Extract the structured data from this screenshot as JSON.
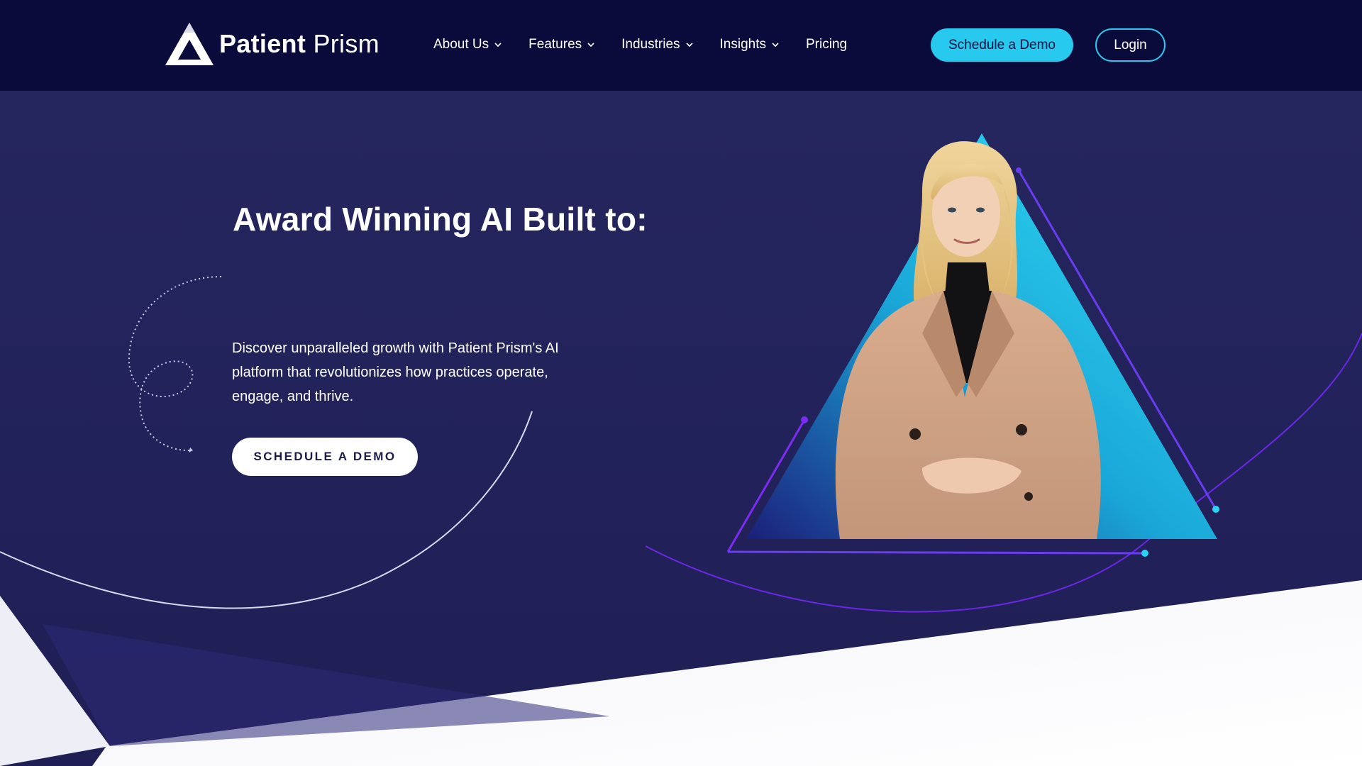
{
  "header": {
    "logo": {
      "bold": "Patient",
      "light": "Prism"
    },
    "nav": [
      {
        "label": "About Us",
        "has_dropdown": true
      },
      {
        "label": "Features",
        "has_dropdown": true
      },
      {
        "label": "Industries",
        "has_dropdown": true
      },
      {
        "label": "Insights",
        "has_dropdown": true
      },
      {
        "label": "Pricing",
        "has_dropdown": false
      }
    ],
    "cta_label": "Schedule a Demo",
    "login_label": "Login"
  },
  "hero": {
    "title": "Award Winning AI Built to:",
    "description": "Discover unparalleled growth with Patient Prism's AI platform that revolutionizes how practices operate, engage, and thrive.",
    "cta_label": "SCHEDULE A DEMO"
  },
  "colors": {
    "header_bg": "#0b0b3b",
    "hero_bg": "#22215a",
    "accent_cyan": "#27c9ef",
    "accent_purple": "#7b2cf0",
    "white": "#ffffff"
  },
  "icons": {
    "logo": "prism-triangle-logo-icon",
    "dropdown": "chevron-down-icon",
    "decor_path": "dotted-curve-arrow-icon"
  }
}
